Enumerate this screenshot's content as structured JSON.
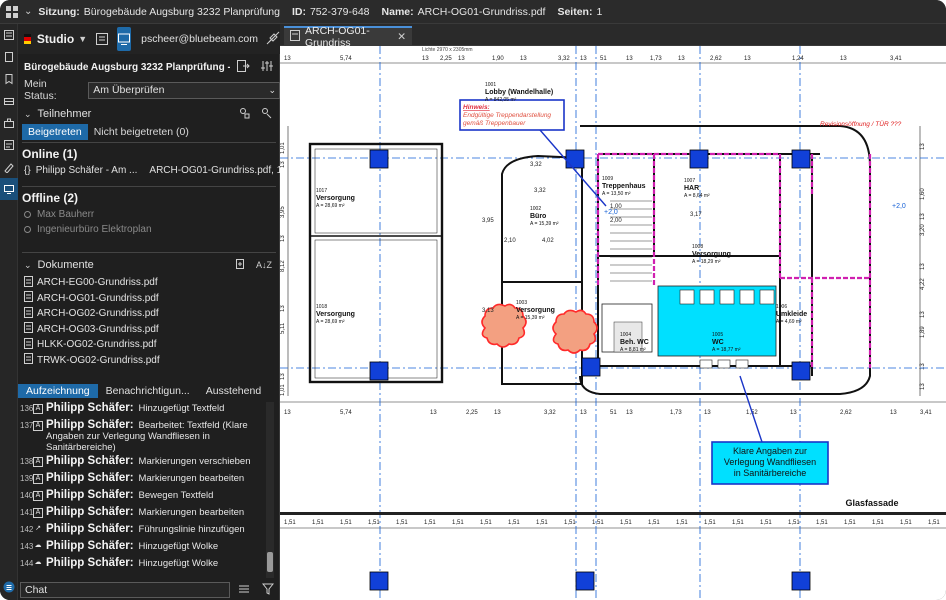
{
  "session": {
    "session_label": "Sitzung:",
    "session_value": "Bürogebäude Augsburg 3232 Planprüfung",
    "id_label": "ID:",
    "id_value": "752-379-648",
    "name_label": "Name:",
    "name_value": "ARCH-OG01-Grundriss.pdf",
    "pages_label": "Seiten:",
    "pages_value": "1"
  },
  "studio": {
    "label": "Studio",
    "user": "pscheer@bluebeam.com"
  },
  "panel": {
    "session_title": "Bürogebäude Augsburg 3232 Planprüfung - 752-379-648",
    "status_label": "Mein Status:",
    "status_value": "Am Überprüfen"
  },
  "participants": {
    "header": "Teilnehmer",
    "tab_joined": "Beigetreten",
    "tab_not_joined": "Nicht beigetreten (0)",
    "online_header": "Online (1)",
    "online": [
      {
        "name": "Philipp Schäfer - Am ...",
        "doc": "ARCH-OG01-Grundriss.pdf, 1"
      }
    ],
    "offline_header": "Offline (2)",
    "offline": [
      "Max Bauherr",
      "Ingenieurbüro Elektroplan"
    ]
  },
  "documents": {
    "header": "Dokumente",
    "items": [
      "ARCH-EG00-Grundriss.pdf",
      "ARCH-OG01-Grundriss.pdf",
      "ARCH-OG02-Grundriss.pdf",
      "ARCH-OG03-Grundriss.pdf",
      "HLKK-OG02-Grundriss.pdf",
      "TRWK-OG02-Grundriss.pdf"
    ]
  },
  "record": {
    "tab_record": "Aufzeichnung",
    "tab_notify": "Benachrichtigun...",
    "tab_pending": "Ausstehend",
    "items": [
      {
        "num": "136",
        "icon": "A",
        "name": "Philipp Schäfer:",
        "action": "Hinzugefügt Textfeld"
      },
      {
        "num": "137",
        "icon": "A",
        "name": "Philipp Schäfer:",
        "action": "Bearbeitet: Textfeld (Klare Angaben zur Verlegung Wandfliesen  in Sanitärbereiche)"
      },
      {
        "num": "138",
        "icon": "A",
        "name": "Philipp Schäfer:",
        "action": "Markierungen verschieben"
      },
      {
        "num": "139",
        "icon": "A",
        "name": "Philipp Schäfer:",
        "action": "Markierungen bearbeiten"
      },
      {
        "num": "140",
        "icon": "A",
        "name": "Philipp Schäfer:",
        "action": "Bewegen Textfeld"
      },
      {
        "num": "141",
        "icon": "A",
        "name": "Philipp Schäfer:",
        "action": "Markierungen bearbeiten"
      },
      {
        "num": "142",
        "icon": "↗",
        "name": "Philipp Schäfer:",
        "action": "Führungslinie hinzufügen"
      },
      {
        "num": "143",
        "icon": "☁",
        "name": "Philipp Schäfer:",
        "action": "Hinzugefügt Wolke"
      },
      {
        "num": "144",
        "icon": "☁",
        "name": "Philipp Schäfer:",
        "action": "Hinzugefügt Wolke"
      }
    ]
  },
  "chat": {
    "placeholder": "Chat"
  },
  "doc_tab": {
    "label": "ARCH-OG01-Grundriss"
  },
  "drawing": {
    "scale_note": "Lichte 2970 x 2305mm",
    "rooms": [
      {
        "id": "1001",
        "name": "Lobby (Wandelhalle)",
        "area": "A = 842,05 m²"
      },
      {
        "id": "1017",
        "name": "Versorgung",
        "area": "A = 28,69 m²"
      },
      {
        "id": "1018",
        "name": "Versorgung",
        "area": "A = 28,69 m²"
      },
      {
        "id": "1002",
        "name": "Büro",
        "area": "A = 15,39 m²"
      },
      {
        "id": "1003",
        "name": "Versorgung",
        "area": "A = 15,39 m²"
      },
      {
        "id": "1009",
        "name": "Treppenhaus",
        "area": "A = 13,50 m²"
      },
      {
        "id": "1007",
        "name": "HAR",
        "area": "A = 8,64 m²"
      },
      {
        "id": "1008",
        "name": "Versorgung",
        "area": "A = 18,29 m²"
      },
      {
        "id": "1004",
        "name": "Beh. WC",
        "area": "A = 8,81 m²"
      },
      {
        "id": "1005",
        "name": "WC",
        "area": "A = 18,77 m²"
      },
      {
        "id": "1006",
        "name": "Umkleide",
        "area": "A = 4,69 m²"
      }
    ],
    "hint_title": "Hinweis:",
    "hint_line1": "Endgültige Treppendarstellung",
    "hint_line2": "gemäß Treppenbauer",
    "revision_note": "Revisionsöffnung / TÜR ???",
    "callout_line1": "Klare Angaben zur",
    "callout_line2": "Verlegung Wandfliesen",
    "callout_line3": "in Sanitärbereiche",
    "facade_label": "Glasfassade",
    "level_mark": "+2,0",
    "top_dims": [
      "13",
      "5,74",
      "13",
      "2,25",
      "13",
      "1,90",
      "13",
      "3,32",
      "13",
      "51",
      "13",
      "1,73",
      "13",
      "2,62",
      "13",
      "1,24",
      "13",
      "3,41"
    ],
    "bottom_dims": [
      "13",
      "5,74",
      "13",
      "2,25",
      "13",
      "3,32",
      "13",
      "51",
      "13",
      "1,73",
      "13",
      "1,52",
      "13",
      "2,62",
      "13",
      "3,41"
    ],
    "fassade_dims": [
      "1,51",
      "1,51",
      "1,51",
      "1,51",
      "1,51",
      "1,51",
      "1,51",
      "1,51",
      "1,51",
      "1,51",
      "1,51",
      "1,51",
      "1,51",
      "1,51",
      "1,51",
      "1,51",
      "1,51",
      "1,51",
      "1,51",
      "1,51",
      "1,51",
      "1,51",
      "1,51",
      "1,51"
    ],
    "left_dims": [
      "1,01",
      "13",
      "3,95",
      "13",
      "8,12",
      "13",
      "5,11",
      "13",
      "1,01"
    ],
    "right_dims": [
      "13",
      "1,60",
      "13",
      "3,20",
      "13",
      "4,22",
      "13",
      "1,89",
      "13",
      "13"
    ],
    "misc_labels": [
      "3,32",
      "3,32",
      "2,10",
      "4,02",
      "1,00",
      "3,17",
      "2,00",
      "3,95",
      "3,13"
    ]
  },
  "colors": {
    "accent": "#1e6aa8",
    "markup_blue": "#1a35c8",
    "markup_red": "#ff2a2a",
    "cloud_fill": "#f3a081",
    "wc_fill": "#00e0ff",
    "grid_blue": "#1560d6"
  }
}
